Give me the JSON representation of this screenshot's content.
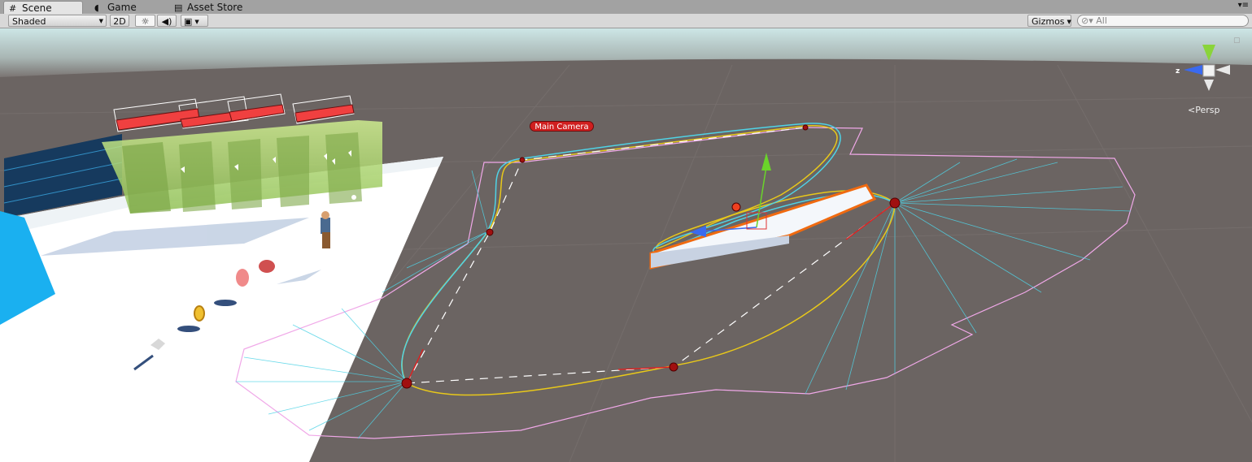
{
  "tabs": [
    {
      "label": "Scene",
      "icon": "grid-icon",
      "active": true
    },
    {
      "label": "Game",
      "icon": "pacman-icon",
      "active": false
    },
    {
      "label": "Asset Store",
      "icon": "store-icon",
      "active": false
    }
  ],
  "toolbar": {
    "render_mode": "Shaded",
    "mode_2d": "2D",
    "gizmos_label": "Gizmos",
    "search_placeholder": "All"
  },
  "scene": {
    "camera_label": "Main Camera",
    "projection_label": "Persp",
    "axis_z_label": "z"
  },
  "colors": {
    "sky_top": "#c4e0e0",
    "ground": "#6b6462",
    "spline_yellow": "#e8c81a",
    "spline_cyan": "#4fd3e6",
    "boundary_pink": "#f0a8e8",
    "selection_orange": "#f06a10",
    "camera_red": "#d01f1f"
  }
}
